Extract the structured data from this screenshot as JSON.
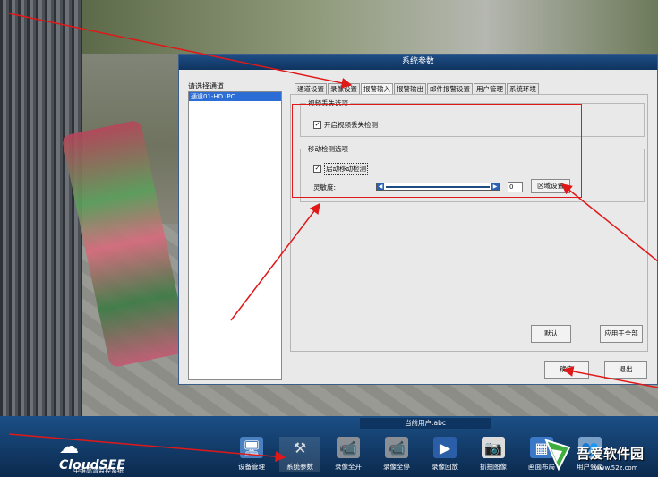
{
  "dialog": {
    "title": "系统参数",
    "channel_label": "请选择通道",
    "channels": [
      "通道01-HD IPC"
    ],
    "tabs": [
      "通道设置",
      "录像设置",
      "报警输入",
      "报警输出",
      "邮件报警设置",
      "用户管理",
      "系统环境"
    ],
    "active_tab_index": 2,
    "video_loss": {
      "legend": "视频丢失选项",
      "checkbox_label": "开启视频丢失检测",
      "checked": true
    },
    "motion": {
      "legend": "移动检测选项",
      "checkbox_label": "启动移动检测",
      "checked": true,
      "sensitivity_label": "灵敏度:",
      "sensitivity_value": "0",
      "region_button": "区域设置"
    },
    "buttons": {
      "default": "默认",
      "apply_all": "应用于全部",
      "ok": "确定",
      "exit": "退出"
    }
  },
  "taskbar": {
    "current_user": "当前用户:abc",
    "brand": "CloudSEE",
    "brand_sub": "中维高清监控系统",
    "items": [
      "设备管理",
      "系统参数",
      "录像全开",
      "录像全停",
      "录像回放",
      "抓拍图像",
      "画面布局",
      "用户登录"
    ]
  },
  "watermark": {
    "text": "吾爱软件园",
    "url": "www.52z.com"
  },
  "colors": {
    "title_bar": "#1e4d86",
    "taskbar": "#0b2a4e",
    "annotation_red": "#e01818",
    "selected_channel": "#2c6dd5"
  }
}
